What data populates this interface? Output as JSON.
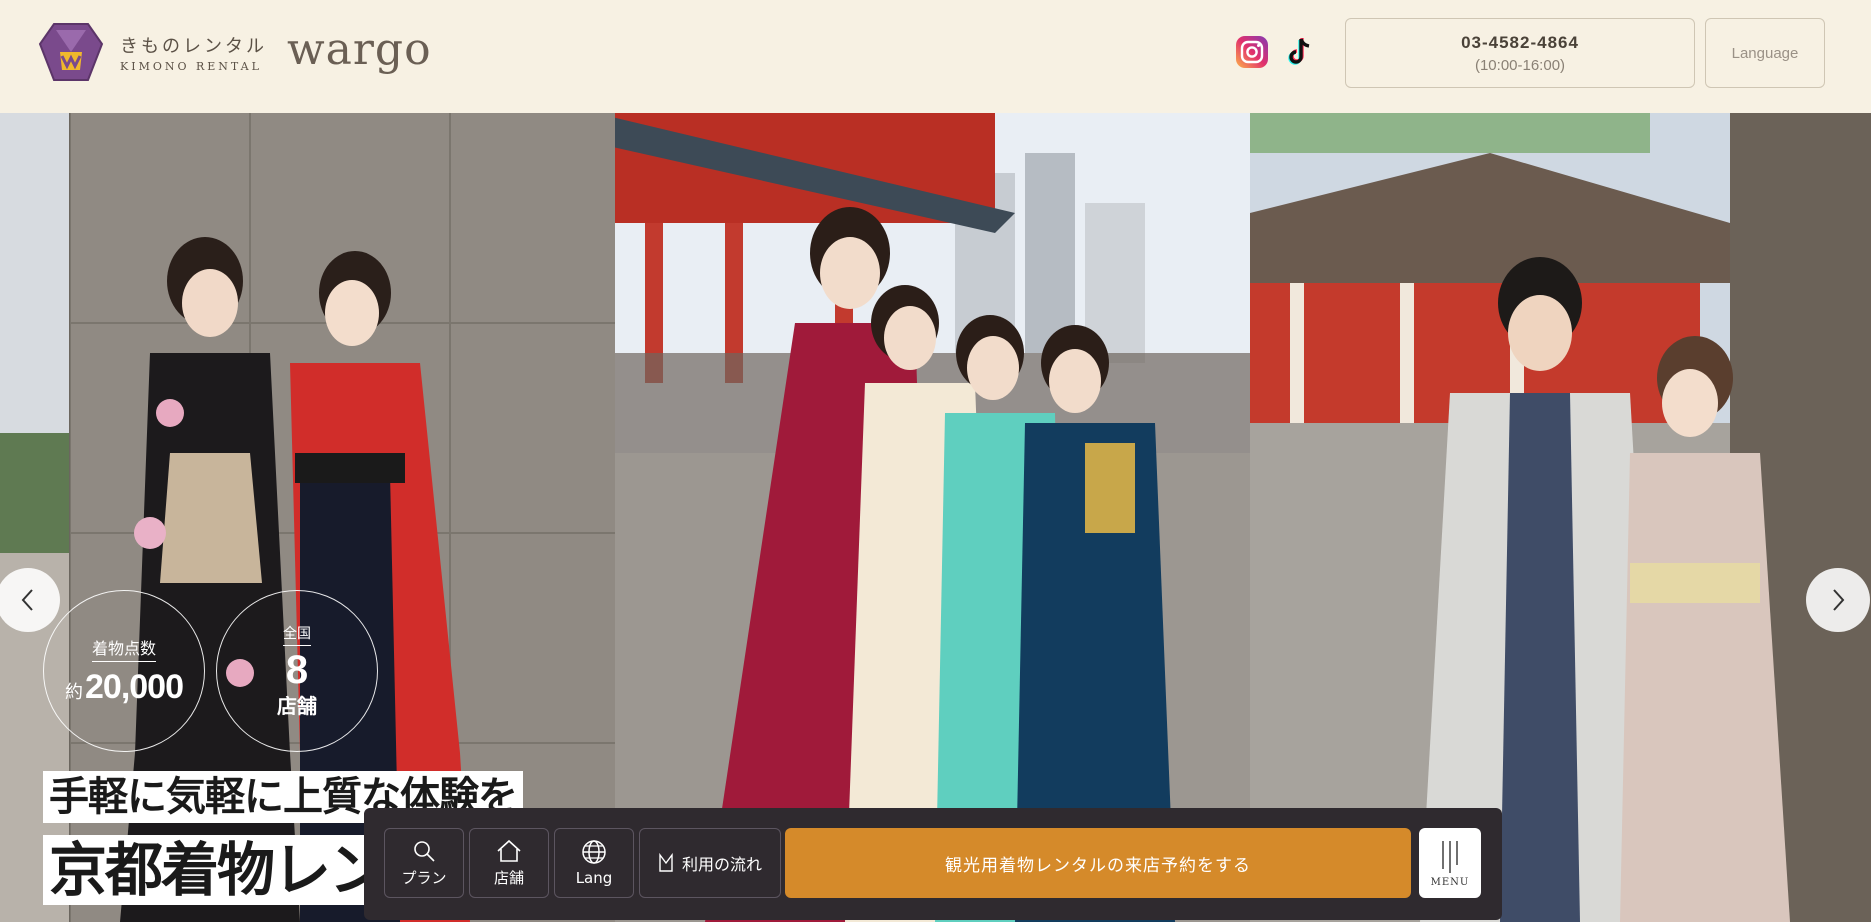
{
  "header": {
    "logo_jp": "きものレンタル",
    "logo_en": "KIMONO RENTAL",
    "logo_brand": "wargo",
    "social": [
      {
        "icon": "instagram-icon"
      },
      {
        "icon": "tiktok-icon"
      }
    ],
    "phone": {
      "number": "03-4582-4864",
      "hours": "(10:00-16:00)"
    },
    "language_label": "Language"
  },
  "hero": {
    "stats": {
      "count_label": "着物点数",
      "count_prefix": "約",
      "count_value": "20,000",
      "stores_label": "全国",
      "stores_value": "8",
      "stores_unit": "店舗"
    },
    "tagline_line1": "手軽に気軽に上質な体験を",
    "tagline_line2": "京都着物レンタル"
  },
  "bottom_nav": {
    "plan_label": "プラン",
    "store_label": "店舗",
    "lang_label": "Lang",
    "flow_label": "利用の流れ",
    "reserve_label": "観光用着物レンタルの来店予約をする",
    "menu_label": "MENU"
  },
  "colors": {
    "header_bg": "#f7f1e3",
    "brand_purple": "#7a4a8c",
    "reserve_orange": "#d58a2a",
    "nav_dark": "#2f2a2f"
  }
}
